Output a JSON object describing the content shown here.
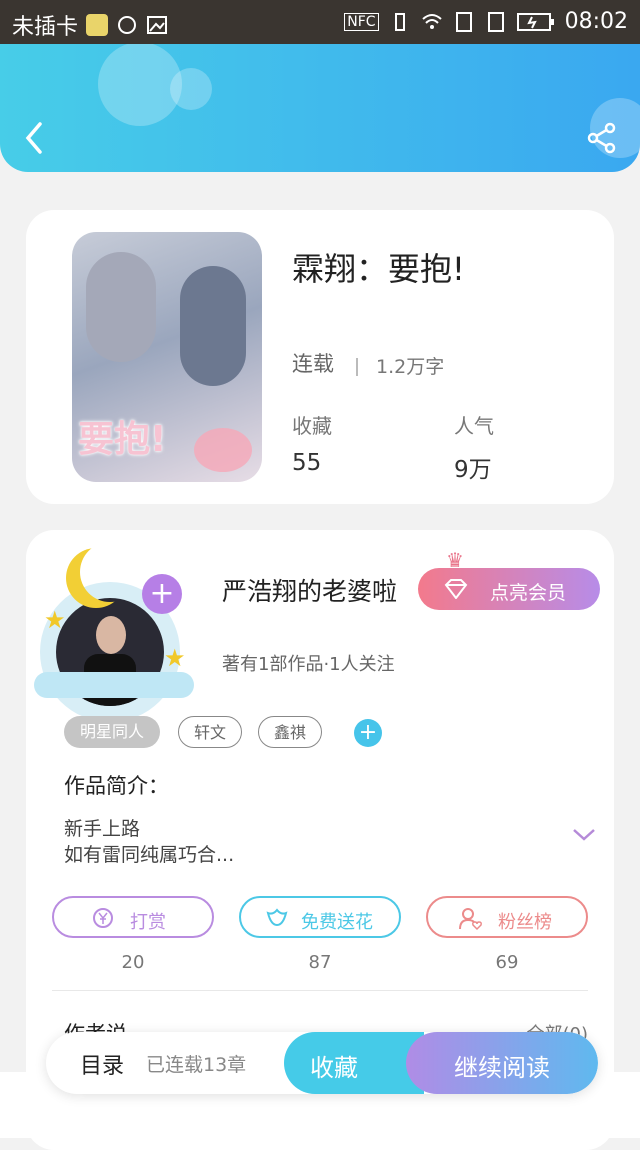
{
  "status_bar": {
    "carrier": "未插卡",
    "time": "08:02"
  },
  "book": {
    "cover_text": "要抱!",
    "title": "霖翔：要抱!",
    "status": "连载",
    "word_count": "1.2万字",
    "stats": [
      {
        "label": "收藏",
        "value": "55"
      },
      {
        "label": "人气",
        "value": "9万"
      }
    ]
  },
  "author": {
    "name": "严浩翔的老婆啦",
    "vip_label": "点亮会员",
    "meta": "著有1部作品·1人关注",
    "tags": [
      "明星同人",
      "轩文",
      "鑫祺"
    ]
  },
  "intro": {
    "title": "作品简介：",
    "lines": [
      "新手上路",
      "如有雷同纯属巧合..."
    ]
  },
  "actions": [
    {
      "label": "打赏",
      "count": "20",
      "color": "#b98ce0"
    },
    {
      "label": "免费送花",
      "count": "87",
      "color": "#4cc8e6"
    },
    {
      "label": "粉丝榜",
      "count": "69",
      "color": "#ec8b8b"
    }
  ],
  "author_says": {
    "title": "作者说",
    "link": "全部(0)"
  },
  "bottom_bar": {
    "toc": "目录",
    "chapters": "已连载13章",
    "fav": "收藏",
    "read": "继续阅读"
  }
}
